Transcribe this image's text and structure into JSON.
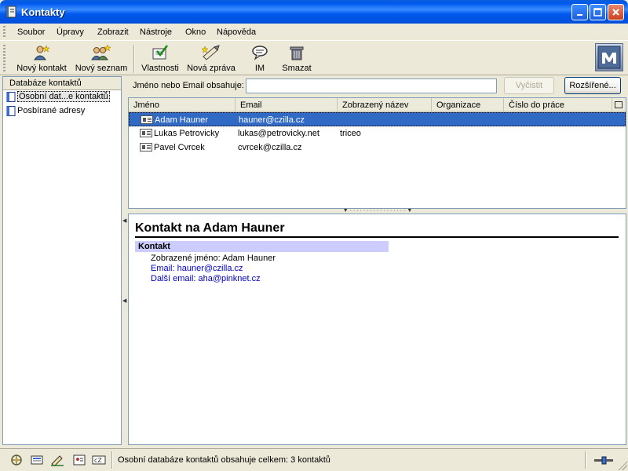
{
  "window": {
    "title": "Kontakty"
  },
  "menu": [
    "Soubor",
    "Úpravy",
    "Zobrazit",
    "Nástroje",
    "Okno",
    "Nápověda"
  ],
  "toolbar": {
    "new_contact": "Nový kontakt",
    "new_list": "Nový seznam",
    "properties": "Vlastnosti",
    "new_message": "Nová zpráva",
    "im": "IM",
    "delete": "Smazat"
  },
  "sidebar": {
    "header": "Databáze kontaktů",
    "items": [
      "Osobní dat...e kontaktů",
      "Posbírané adresy"
    ]
  },
  "search": {
    "label": "Jméno nebo Email obsahuje:",
    "value": "",
    "clear": "Vyčistit",
    "advanced": "Rozšířené..."
  },
  "table": {
    "columns": [
      "Jméno",
      "Email",
      "Zobrazený název",
      "Organizace",
      "Číslo do práce"
    ],
    "rows": [
      {
        "name": "Adam Hauner",
        "email": "hauner@czilla.cz",
        "display": "",
        "org": "",
        "phone": ""
      },
      {
        "name": "Lukas Petrovicky",
        "email": "lukas@petrovicky.net",
        "display": "triceo",
        "org": "",
        "phone": ""
      },
      {
        "name": "Pavel Cvrcek",
        "email": "cvrcek@czilla.cz",
        "display": "",
        "org": "",
        "phone": ""
      }
    ]
  },
  "detail": {
    "title": "Kontakt na Adam Hauner",
    "section": "Kontakt",
    "display_name": "Zobrazené jméno: Adam Hauner",
    "email": "Email: hauner@czilla.cz",
    "other_email": "Další email: aha@pinknet.cz"
  },
  "status": {
    "text": "Osobní databáze kontaktů obsahuje celkem: 3 kontaktů"
  },
  "colors": {
    "title_bar": "#0058EE",
    "selection": "#316AC5",
    "section_head": "#CCCCFF",
    "link": "#0000CC"
  }
}
